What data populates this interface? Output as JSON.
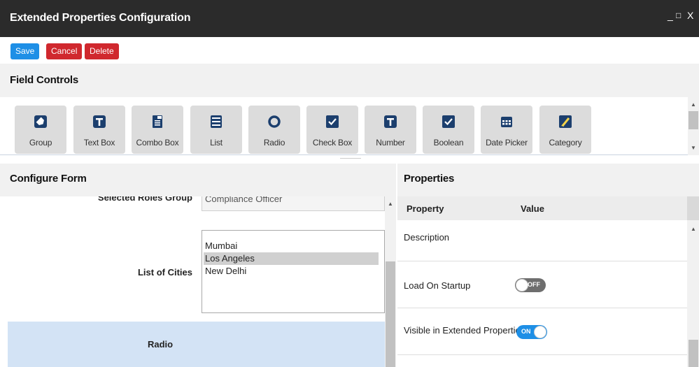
{
  "window": {
    "title": "Extended Properties Configuration",
    "minimize": "_",
    "maximize": "□",
    "close": "X"
  },
  "toolbar": {
    "save_label": "Save",
    "cancel_label": "Cancel",
    "delete_label": "Delete"
  },
  "field_controls": {
    "title": "Field Controls",
    "tiles": [
      {
        "label": "Group",
        "icon": "tag-icon"
      },
      {
        "label": "Text Box",
        "icon": "text-box-icon"
      },
      {
        "label": "Combo Box",
        "icon": "combo-box-icon"
      },
      {
        "label": "List",
        "icon": "list-icon"
      },
      {
        "label": "Radio",
        "icon": "radio-icon"
      },
      {
        "label": "Check Box",
        "icon": "checkbox-icon"
      },
      {
        "label": "Number",
        "icon": "number-icon"
      },
      {
        "label": "Boolean",
        "icon": "boolean-icon"
      },
      {
        "label": "Date Picker",
        "icon": "calendar-icon"
      },
      {
        "label": "Category",
        "icon": "category-icon"
      }
    ]
  },
  "configure_form": {
    "title": "Configure Form",
    "rows": {
      "selected_roles_group": {
        "label": "Selected Roles Group",
        "value": "Compliance Officer"
      },
      "list_of_cities": {
        "label": "List of Cities",
        "items": [
          "Mumbai",
          "Los Angeles",
          "New Delhi"
        ],
        "selected": "Los Angeles"
      },
      "radio": {
        "label": "Radio"
      }
    }
  },
  "properties": {
    "title": "Properties",
    "columns": {
      "property": "Property",
      "value": "Value"
    },
    "rows": [
      {
        "name": "Description",
        "value": ""
      },
      {
        "name": "Load On Startup",
        "toggle": "OFF"
      },
      {
        "name": "Visible in Extended Properties",
        "toggle": "ON"
      }
    ]
  },
  "colors": {
    "titlebar": "#2b2b2b",
    "save": "#1e8fe6",
    "danger": "#d0282e",
    "toggle_on": "#1e8fe6",
    "toggle_off": "#6e6e6e",
    "icon_blue": "#1c3f6e",
    "selected_row": "#d3e3f5"
  }
}
